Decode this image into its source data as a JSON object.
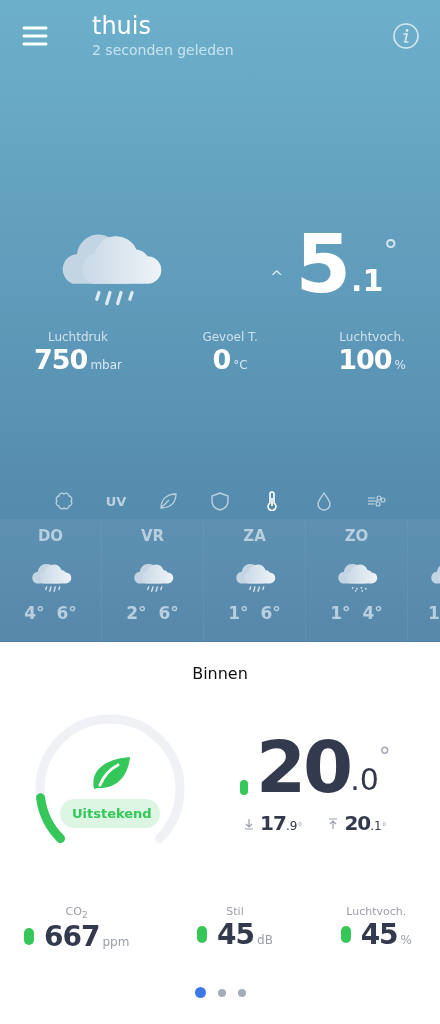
{
  "header": {
    "title": "thuis",
    "subtitle": "2 seconden geleden"
  },
  "current": {
    "trend": "^",
    "temp_whole": "5",
    "temp_decimal": ".1",
    "degree": "°"
  },
  "stats": [
    {
      "label": "Luchtdruk",
      "value": "750",
      "unit": "mbar"
    },
    {
      "label": "Gevoel T.",
      "value": "0",
      "unit": "°C"
    },
    {
      "label": "Luchtvoch.",
      "value": "100",
      "unit": "%"
    }
  ],
  "metric_tabs": [
    {
      "kind": "pollen",
      "selected": false
    },
    {
      "kind": "uv",
      "text": "UV",
      "selected": false
    },
    {
      "kind": "leaf",
      "selected": false
    },
    {
      "kind": "shield",
      "selected": false
    },
    {
      "kind": "thermometer",
      "selected": true
    },
    {
      "kind": "drop",
      "selected": false
    },
    {
      "kind": "wind",
      "selected": false
    }
  ],
  "forecast": [
    {
      "day": "DO",
      "low": "4°",
      "high": "6°",
      "kind": "rain"
    },
    {
      "day": "VR",
      "low": "2°",
      "high": "6°",
      "kind": "rain"
    },
    {
      "day": "ZA",
      "low": "1°",
      "high": "6°",
      "kind": "rain"
    },
    {
      "day": "ZO",
      "low": "1°",
      "high": "4°",
      "kind": "sleet"
    },
    {
      "low": "1",
      "kind": "rain",
      "partial": true
    }
  ],
  "indoor": {
    "title": "Binnen",
    "gauge": {
      "status": "Uitstekend"
    },
    "temp_whole": "20",
    "temp_decimal": ".0",
    "degree": "°",
    "min": {
      "whole": "17",
      "decimal": ".9",
      "degree": "°"
    },
    "max": {
      "whole": "20",
      "decimal": ".1",
      "degree": "°"
    }
  },
  "readings": [
    {
      "label": "CO$_{2}$",
      "value": "667",
      "unit": "ppm",
      "color": "#35c759"
    },
    {
      "label": "Stil",
      "value": "45",
      "unit": "dB",
      "color": "#35c759"
    },
    {
      "label": "Luchtvoch.",
      "value": "45",
      "unit": "%",
      "color": "#35c759"
    }
  ],
  "pages": [
    {
      "selected": true
    },
    {
      "selected": false
    },
    {
      "selected": false
    }
  ]
}
